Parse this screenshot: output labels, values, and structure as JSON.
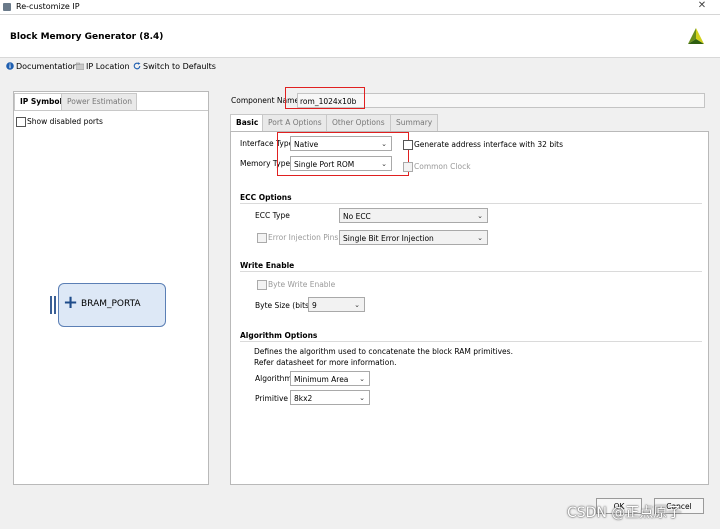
{
  "window": {
    "title": "Re-customize IP",
    "close_glyph": "✕"
  },
  "header": {
    "title": "Block Memory Generator (8.4)",
    "logo_icon": "xilinx-logo-icon"
  },
  "toolbar": {
    "documentation": "Documentation",
    "ip_location": "IP Location",
    "switch_defaults": "Switch to Defaults"
  },
  "left_panel": {
    "tabs": [
      "IP Symbol",
      "Power Estimation"
    ],
    "show_disabled_ports": "Show disabled ports",
    "symbol": {
      "port_label": "BRAM_PORTA",
      "expand_glyph": "+"
    }
  },
  "right_panel": {
    "component_name_label": "Component Name",
    "component_name_value": "rom_1024x10b",
    "tabs": [
      "Basic",
      "Port A Options",
      "Other Options",
      "Summary"
    ],
    "interface_type_label": "Interface Type",
    "interface_type_value": "Native",
    "memory_type_label": "Memory Type",
    "memory_type_value": "Single Port ROM",
    "gen_address_label": "Generate address interface with 32 bits",
    "common_clock_label": "Common Clock",
    "ecc": {
      "title": "ECC Options",
      "ecc_type_label": "ECC Type",
      "ecc_type_value": "No ECC",
      "error_injection_label": "Error Injection Pins",
      "error_injection_value": "Single Bit Error Injection"
    },
    "write_enable": {
      "title": "Write Enable",
      "byte_write_label": "Byte Write Enable",
      "byte_size_label": "Byte Size (bits)",
      "byte_size_value": "9"
    },
    "algorithm": {
      "title": "Algorithm Options",
      "desc1": "Defines the algorithm used to concatenate the block RAM primitives.",
      "desc2": "Refer datasheet for more information.",
      "algorithm_label": "Algorithm",
      "algorithm_value": "Minimum Area",
      "primitive_label": "Primitive",
      "primitive_value": "8kx2"
    }
  },
  "footer": {
    "ok": "OK",
    "cancel": "Cancel",
    "watermark": "CSDN @正点原子"
  },
  "chevron": "⌄",
  "colors": {
    "highlight_box": "#e02020",
    "symbol_fill": "#dde8f6",
    "symbol_border": "#5b7fb5"
  }
}
